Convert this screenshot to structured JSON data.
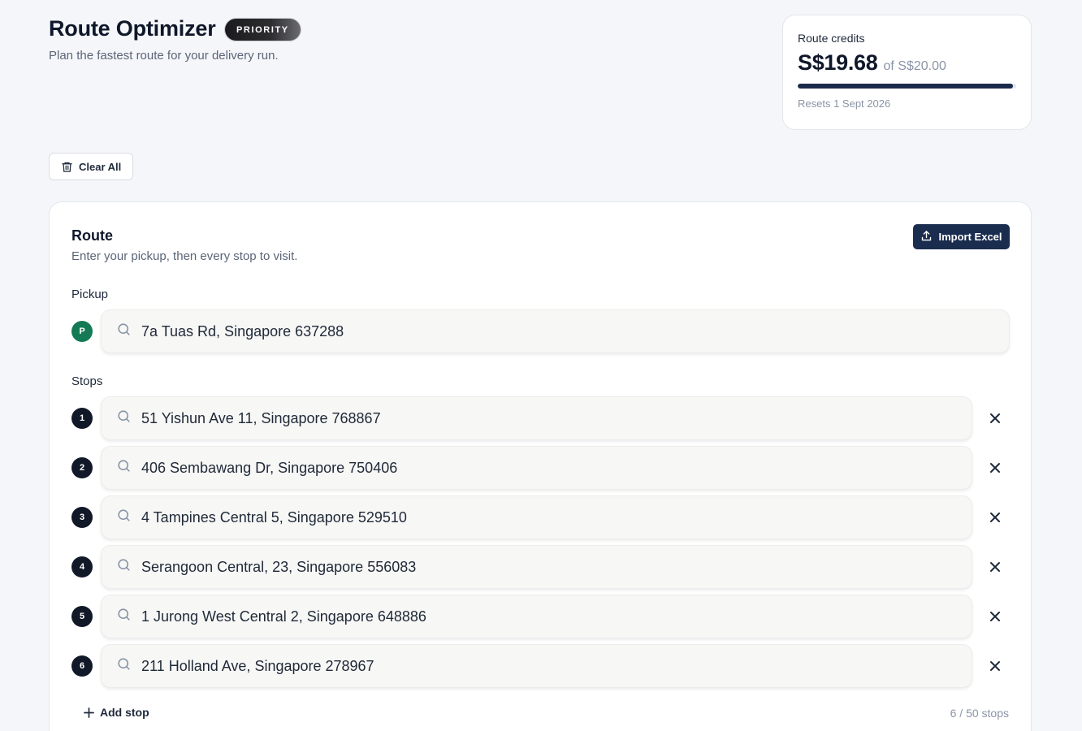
{
  "header": {
    "title": "Route Optimizer",
    "badge": "PRIORITY",
    "subtitle": "Plan the fastest route for your delivery run."
  },
  "credits": {
    "label": "Route credits",
    "amount": "S$19.68",
    "total": "of S$20.00",
    "used_fraction": 0.984,
    "reset": "Resets 1 Sept 2026"
  },
  "toolbar": {
    "clear_label": "Clear All"
  },
  "route": {
    "title": "Route",
    "subtitle": "Enter your pickup, then every stop to visit.",
    "import_label": "Import Excel",
    "pickup_label": "Pickup",
    "pickup": {
      "marker": "P",
      "value": "7a Tuas Rd, Singapore 637288"
    },
    "stops_label": "Stops",
    "stops": [
      {
        "marker": "1",
        "value": "51 Yishun Ave 11, Singapore 768867"
      },
      {
        "marker": "2",
        "value": "406 Sembawang Dr, Singapore 750406"
      },
      {
        "marker": "3",
        "value": "4 Tampines Central 5, Singapore 529510"
      },
      {
        "marker": "4",
        "value": "Serangoon Central, 23, Singapore 556083"
      },
      {
        "marker": "5",
        "value": "1 Jurong West Central 2, Singapore 648886"
      },
      {
        "marker": "6",
        "value": "211 Holland Ave, Singapore 278967"
      }
    ],
    "add_stop_label": "Add stop",
    "stop_count": "6 / 50 stops"
  },
  "colors": {
    "pickup_marker": "#137a55",
    "stop_marker": "#111827",
    "primary_button": "#1b2d4f",
    "progress_fill": "#1b2a4a"
  }
}
